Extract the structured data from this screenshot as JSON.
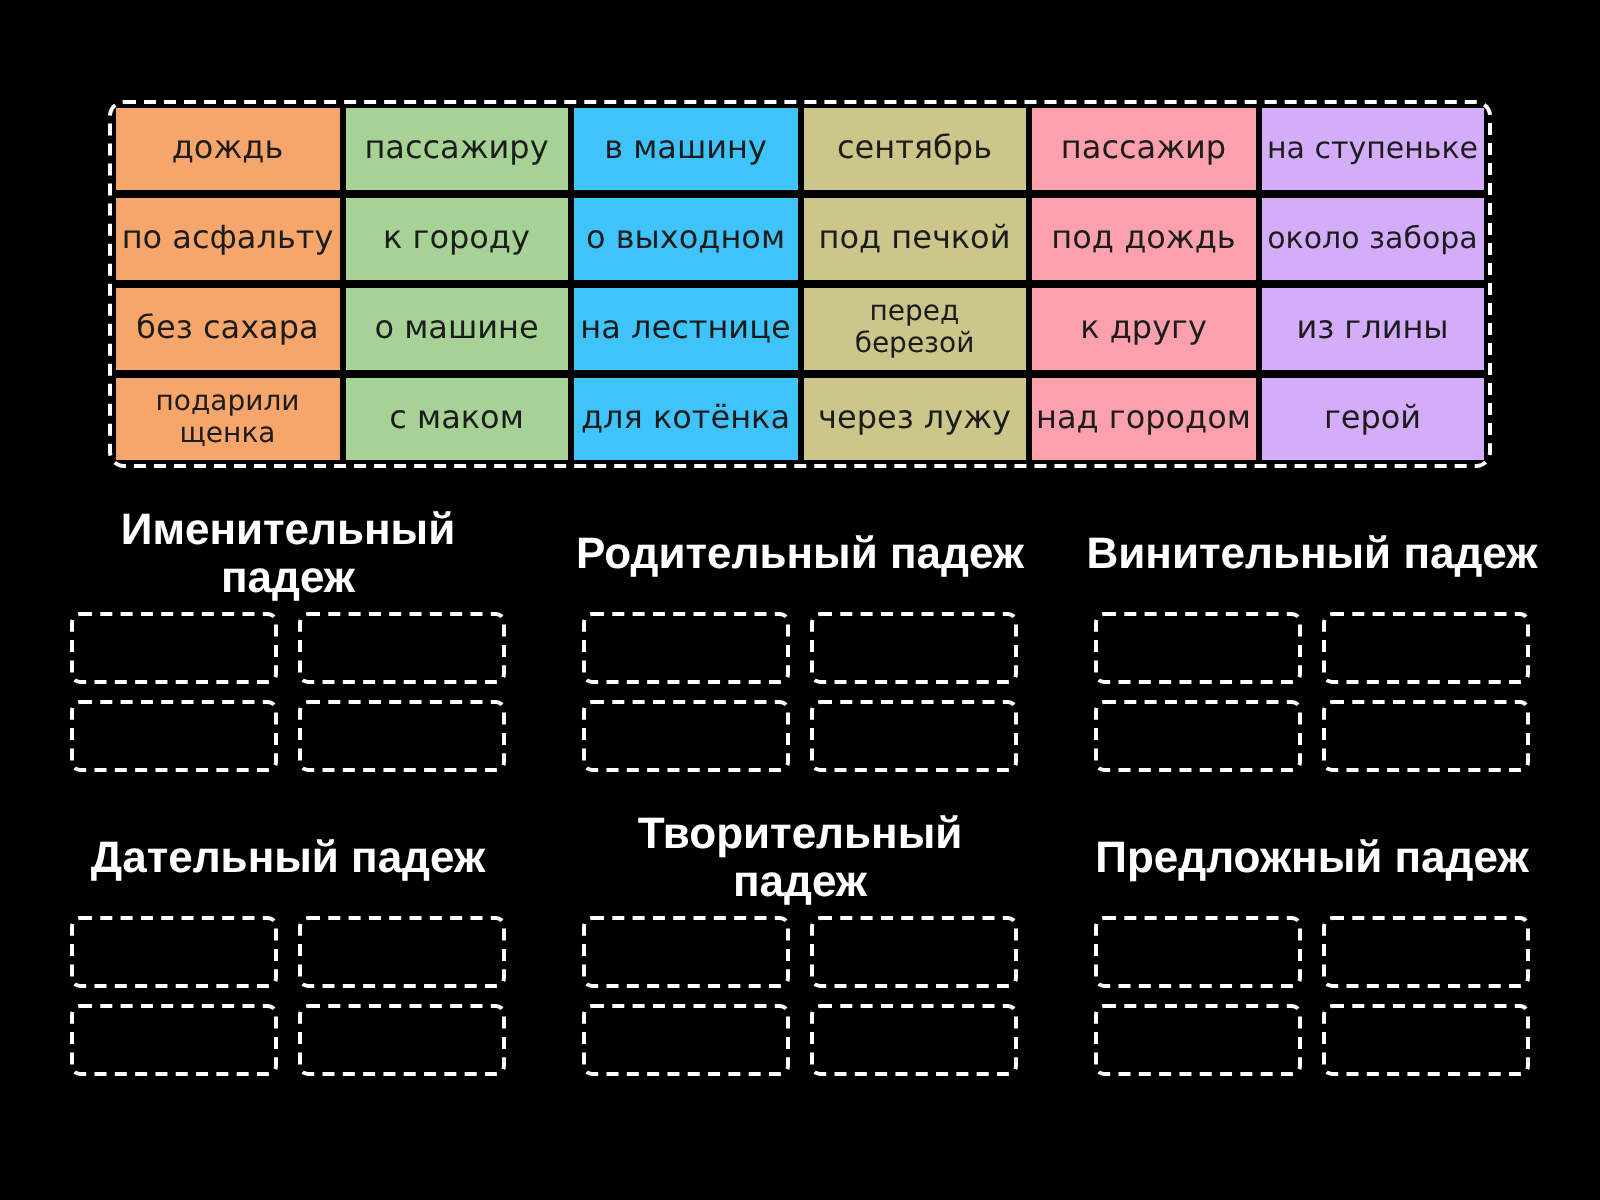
{
  "tile_pool": {
    "tiles": [
      {
        "text": "дождь",
        "color": "#f6a66b"
      },
      {
        "text": "пассажиру",
        "color": "#a6d395"
      },
      {
        "text": "в машину",
        "color": "#3ec4fa"
      },
      {
        "text": "сентябрь",
        "color": "#ccc68b"
      },
      {
        "text": "пассажир",
        "color": "#fda0ad"
      },
      {
        "text": "на ступеньке",
        "color": "#d4adfa"
      },
      {
        "text": "по асфальту",
        "color": "#f6a66b"
      },
      {
        "text": "к городу",
        "color": "#a6d395"
      },
      {
        "text": "о выходном",
        "color": "#3ec4fa"
      },
      {
        "text": "под печкой",
        "color": "#ccc68b"
      },
      {
        "text": "под дождь",
        "color": "#fda0ad"
      },
      {
        "text": "около забора",
        "color": "#d4adfa"
      },
      {
        "text": "без сахара",
        "color": "#f6a66b"
      },
      {
        "text": "о машине",
        "color": "#a6d395"
      },
      {
        "text": "на лестнице",
        "color": "#3ec4fa"
      },
      {
        "text": "перед березой",
        "color": "#ccc68b"
      },
      {
        "text": "к другу",
        "color": "#fda0ad"
      },
      {
        "text": "из глины",
        "color": "#d4adfa"
      },
      {
        "text": "подарили щенка",
        "color": "#f6a66b"
      },
      {
        "text": "с маком",
        "color": "#a6d395"
      },
      {
        "text": "для котёнка",
        "color": "#3ec4fa"
      },
      {
        "text": "через лужу",
        "color": "#ccc68b"
      },
      {
        "text": "над городом",
        "color": "#fda0ad"
      },
      {
        "text": "герой",
        "color": "#d4adfa"
      }
    ]
  },
  "categories": [
    {
      "title": "Именительный падеж",
      "slots": [
        {
          "empty": true
        },
        {
          "empty": true
        },
        {
          "empty": true
        },
        {
          "empty": true
        }
      ]
    },
    {
      "title": "Родительный падеж",
      "slots": [
        {
          "empty": true
        },
        {
          "empty": true
        },
        {
          "empty": true
        },
        {
          "empty": true
        }
      ]
    },
    {
      "title": "Винительный падеж",
      "slots": [
        {
          "empty": true
        },
        {
          "empty": true
        },
        {
          "empty": true
        },
        {
          "empty": true
        }
      ]
    },
    {
      "title": "Дательный падеж",
      "slots": [
        {
          "empty": true
        },
        {
          "empty": true
        },
        {
          "empty": true
        },
        {
          "empty": true
        }
      ]
    },
    {
      "title": "Творительный падеж",
      "slots": [
        {
          "empty": true
        },
        {
          "empty": true
        },
        {
          "empty": true
        },
        {
          "empty": true
        }
      ]
    },
    {
      "title": "Предложный падеж",
      "slots": [
        {
          "empty": true
        },
        {
          "empty": true
        },
        {
          "empty": true
        },
        {
          "empty": true
        }
      ]
    }
  ]
}
